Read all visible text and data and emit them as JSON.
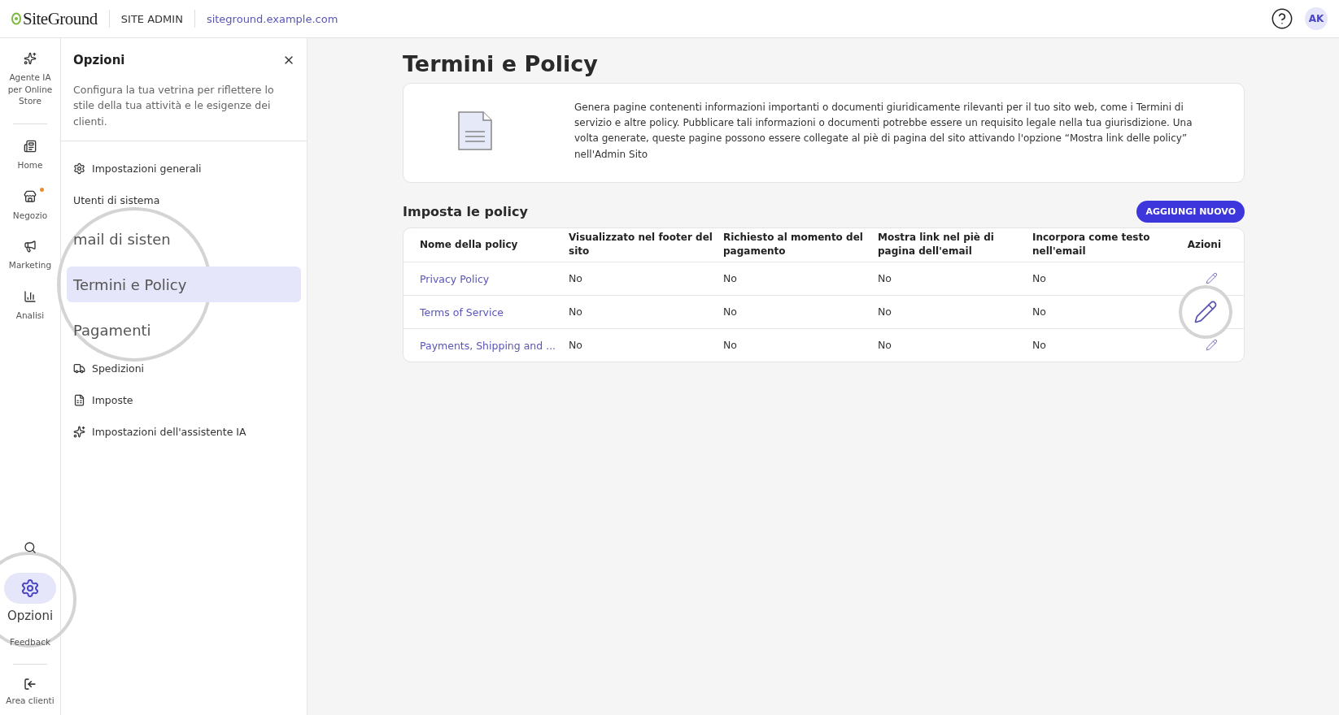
{
  "topbar": {
    "logo": "SiteGround",
    "section": "SITE ADMIN",
    "domain": "siteground.example.com",
    "avatar": "AK"
  },
  "rail": {
    "items": [
      {
        "kind": "sparkles",
        "label": "Agente IA per Online Store",
        "selected": false,
        "notification": false
      },
      {
        "kind": "home",
        "label": "Home",
        "selected": false,
        "notification": false
      },
      {
        "kind": "store",
        "label": "Negozio",
        "selected": false,
        "notification": true
      },
      {
        "kind": "marketing",
        "label": "Marketing",
        "selected": false,
        "notification": false
      },
      {
        "kind": "chart",
        "label": "Analisi",
        "selected": false,
        "notification": false
      }
    ],
    "bottom": [
      {
        "kind": "search",
        "selected": false,
        "magnified": false
      },
      {
        "kind": "settings",
        "label": "Opzioni",
        "selected": true,
        "magnified": true
      },
      {
        "kind": "none",
        "label": "Feedback",
        "selected": false,
        "magnified": false
      }
    ],
    "exit": {
      "label": "Area clienti"
    }
  },
  "options_panel": {
    "title": "Opzioni",
    "description": "Configura la tua vetrina per riflettere lo stile della tua attività e le esigenze dei clienti.",
    "items": [
      {
        "kind": "settings",
        "label": "Impostazioni generali",
        "selected": false,
        "magnified": false
      },
      {
        "kind": "none",
        "label": "Utenti di sistema",
        "selected": false,
        "magnified": false
      },
      {
        "kind": "none",
        "label": "mail di sisten",
        "selected": false,
        "magnified": true
      },
      {
        "kind": "none",
        "label": "Termini e Policy",
        "selected": true,
        "magnified": true
      },
      {
        "kind": "none",
        "label": "Pagamenti",
        "selected": false,
        "magnified": true
      },
      {
        "kind": "truck",
        "label": "Spedizioni",
        "selected": false,
        "magnified": false
      },
      {
        "kind": "tax",
        "label": "Imposte",
        "selected": false,
        "magnified": false
      },
      {
        "kind": "sparkles",
        "label": "Impostazioni dell'assistente IA",
        "selected": false,
        "magnified": false
      }
    ]
  },
  "page": {
    "title": "Termini e Policy",
    "info": "Genera pagine contenenti informazioni importanti o documenti giuridicamente rilevanti per il tuo sito web, come i Termini di servizio e altre policy. Pubblicare tali informazioni o documenti potrebbe essere un requisito legale nella tua giurisdizione. Una volta generate, queste pagine possono essere collegate al piè di pagina del sito attivando l'opzione “Mostra link delle policy” nell'Admin Sito",
    "section_title": "Imposta le policy",
    "add_button": "AGGIUNGI NUOVO",
    "table": {
      "columns": [
        "Nome della policy",
        "Visualizzato nel footer del sito",
        "Richiesto al momento del pagamento",
        "Mostra link nel piè di pagina dell'email",
        "Incorpora come testo nell'email",
        "Azioni"
      ],
      "rows": [
        {
          "cells": [
            "Privacy Policy",
            "No",
            "No",
            "No",
            "No"
          ],
          "edit_magnified": false
        },
        {
          "cells": [
            "Terms of Service",
            "No",
            "No",
            "No",
            "No"
          ],
          "edit_magnified": true
        },
        {
          "cells": [
            "Payments, Shipping and ...",
            "No",
            "No",
            "No",
            "No"
          ],
          "edit_magnified": false
        }
      ]
    }
  }
}
